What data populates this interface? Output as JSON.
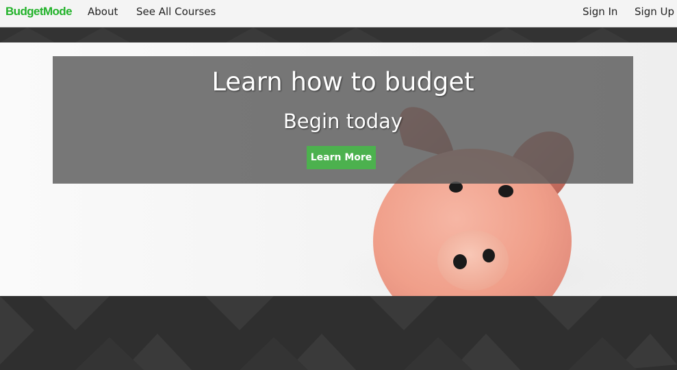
{
  "navbar": {
    "brand": "BudgetMode",
    "links": {
      "about": "About",
      "courses": "See All Courses",
      "sign_in": "Sign In",
      "sign_up": "Sign Up"
    }
  },
  "hero": {
    "title": "Learn how to budget",
    "subtitle": "Begin today",
    "cta_label": "Learn More",
    "image": "piggy-bank-photo"
  },
  "colors": {
    "brand": "#22b22a",
    "cta": "#4cb14e",
    "overlay": "#5a5a5a",
    "footer": "#2f2f2f"
  }
}
